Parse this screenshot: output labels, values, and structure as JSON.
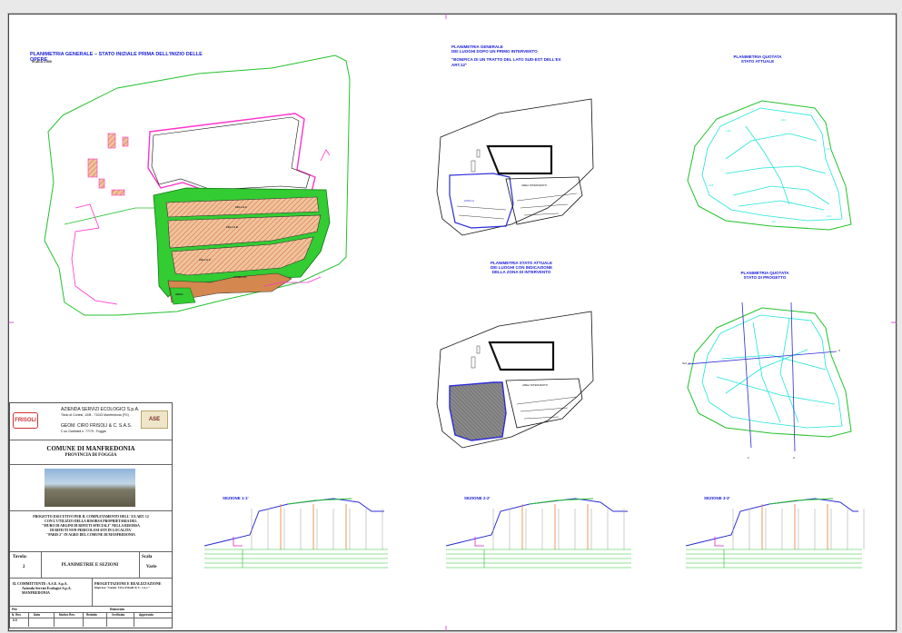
{
  "sheet": {
    "general_plan_title": "PLANIMETRIA GENERALE – STATO INIZIALE PRIMA DELL'INIZIO DELLE OPERE",
    "general_plan_scale": "SCALA 1:500",
    "plan_after_title_lines": [
      "PLANIMETRIA GENERALE",
      "DEI LUOGHI DOPO UN PRIMO INTERVENTO",
      "",
      "\"BONIFICA DI UN TRATTO DEL LATO SUD-EST DELL'EX",
      "ART.12\""
    ],
    "plan_current_title_lines": [
      "PLANIMETRIA STATO ATTUALE",
      "DEI LUOGHI CON INDICAZIONE",
      "DELLA ZONA DI INTERVENTO"
    ],
    "quota_current_title_lines": [
      "PLANIMETRIA QUOTATA",
      "STATO ATTUALE"
    ],
    "quota_project_title_lines": [
      "PLANIMETRIA QUOTATA",
      "STATO DI PROGETTO"
    ],
    "section_titles": [
      "SEZIONE 1-1'",
      "SEZIONE 2-2'",
      "SEZIONE 3-3'"
    ]
  },
  "title_block": {
    "company_line_1": "AZIENDA SERVIZI ECOLOGICI S.p.A.",
    "company_line_2": "Titolo di Cortesi, 10/B - 71043 Manfredonia (FG)",
    "company_line_3": "GEOM. CIRO FRISOLI & C. S.A.S.",
    "company_line_4": "C.so Garibaldi n. 77/79 - Foggia",
    "logo_left": "FRISOLI",
    "logo_right": "ASE",
    "municipality": "COMUNE DI MANFREDONIA",
    "province": "PROVINCIA DI FOGGIA",
    "project_description": [
      "PROGETTO ESECUTIVO PER IL COMPLETAMENTO DELL' EX ART. 12",
      "CON L'UTILIZZO DELLA RISORSA PROPRIETARIA DEL",
      "\"MURO DI ARGINI DI RIFIUTI SPECIALI\" NELLA RISORSA",
      "DI RIFIUTI NON PERICOLOSI SITI IN LOCALITA'",
      "\"PARIS 2\" IN AGRO DEL COMUNE DI MANFREDONIA"
    ],
    "table_label": "Tavola:",
    "table_number": "2",
    "table_content": "PLANIMETRIE E SEZIONI",
    "scale_label": "Scala",
    "scale_value": "Varie",
    "client_lines": [
      "IL COMMITTENTE: A.S.E. S.p.A.",
      "Azienda Servizi Ecologici S.p.A.",
      "MANFREDONIA"
    ],
    "design_lines": [
      "PROGETTAZIONE E REALIZZAZIONE",
      "Impresa \"Geom. Ciro Frisoli & C. s.a.s.\""
    ],
    "footer_file_label": "File",
    "footer_elab_label": "Elaborato",
    "footer_columns": [
      "N. Rev.",
      "Data",
      "Motivo Rev.",
      "Redatto",
      "Verificato",
      "Approvato"
    ],
    "footer_rev": "0.0"
  },
  "colors": {
    "site_green": "#22c12c",
    "fill_green": "#33cc33",
    "fence_magenta": "#ff33cc",
    "title_blue": "#1c22d8",
    "contour_cyan": "#1fe5d9",
    "hatch_orange": "#e98a4c",
    "section_line_blue": "#2c2cd8"
  }
}
